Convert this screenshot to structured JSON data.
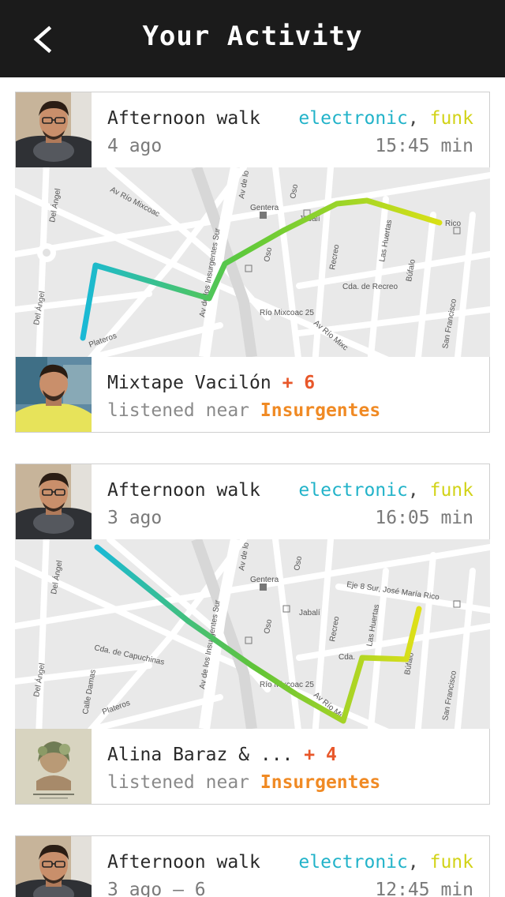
{
  "header": {
    "title": "Your Activity",
    "back_icon": "chevron-left-icon"
  },
  "colors": {
    "topbar": "#1b1b1b",
    "tag_electronic": "#22b3c9",
    "tag_funk": "#d2d318",
    "extra_count": "#e8572a",
    "place": "#f08a24"
  },
  "map": {
    "street_labels": [
      "Av Río Mixcoac",
      "Av de los Insurgentes Sur",
      "Av de lo",
      "Gentera",
      "Oso",
      "Jabalí",
      "Recreo",
      "Las Huertas",
      "Búfalo",
      "Cda. de Recreo",
      "Río Mixcoac 25",
      "Av Río Mixc",
      "San Francisco",
      "Del Ángel",
      "Plateros",
      "Cda. de Capuchinas",
      "Calle Damas",
      "Eje 8 Sur, José María Rico",
      "Rico"
    ]
  },
  "activities": [
    {
      "title": "Afternoon walk",
      "tag1": "electronic",
      "comma": ",",
      "tag2": "funk",
      "ago": "4 ago",
      "duration": "15:45 min",
      "track": "Mixtape Vacilón",
      "extra": "+ 6",
      "near_label": "listened near",
      "place": "Insurgentes"
    },
    {
      "title": "Afternoon walk",
      "tag1": "electronic",
      "comma": ",",
      "tag2": "funk",
      "ago": "3 ago",
      "duration": "16:05 min",
      "track": "Alina Baraz & ...",
      "extra": "+ 4",
      "near_label": "listened near",
      "place": "Insurgentes"
    },
    {
      "title": "Afternoon walk",
      "tag1": "electronic",
      "comma": ",",
      "tag2": "funk",
      "ago": "3 ago – 6",
      "duration": "12:45 min"
    }
  ]
}
